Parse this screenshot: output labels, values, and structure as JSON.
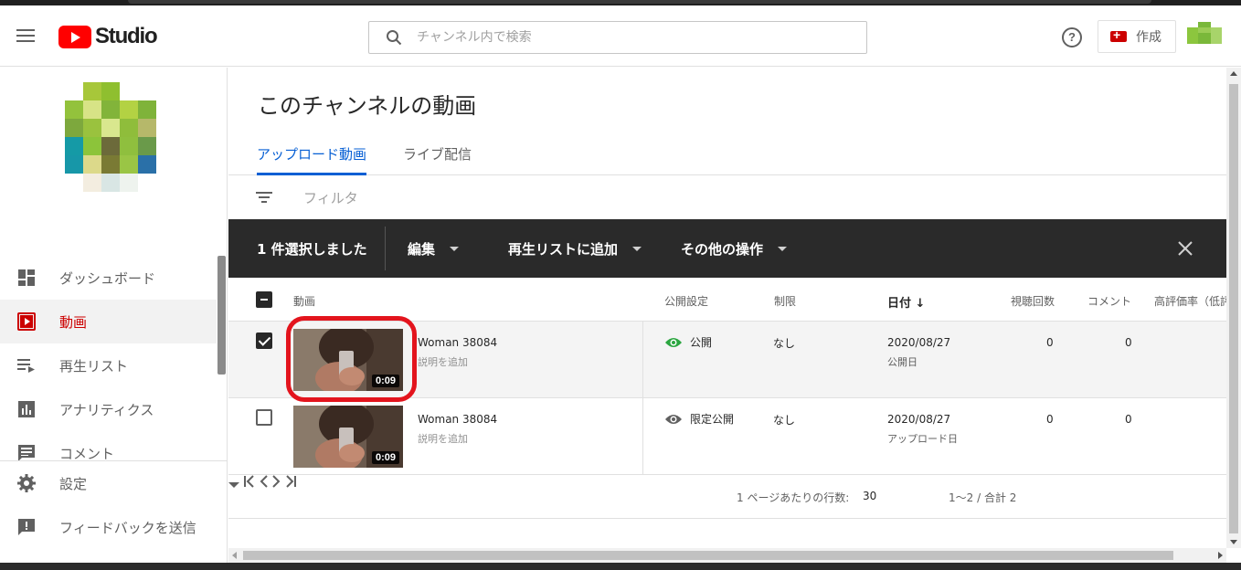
{
  "header": {
    "logo_text": "Studio",
    "search_placeholder": "チャンネル内で検索",
    "help_label": "?",
    "create_label": "作成"
  },
  "sidebar": {
    "items": [
      {
        "label": "ダッシュボード",
        "icon": "dashboard-icon"
      },
      {
        "label": "動画",
        "icon": "video-icon",
        "active": true
      },
      {
        "label": "再生リスト",
        "icon": "playlist-icon"
      },
      {
        "label": "アナリティクス",
        "icon": "analytics-icon"
      },
      {
        "label": "コメント",
        "icon": "comment-icon"
      }
    ],
    "bottom_items": [
      {
        "label": "設定",
        "icon": "gear-icon"
      },
      {
        "label": "フィードバックを送信",
        "icon": "feedback-icon"
      }
    ]
  },
  "main": {
    "title": "このチャンネルの動画",
    "tabs": [
      {
        "label": "アップロード動画",
        "active": true
      },
      {
        "label": "ライブ配信"
      }
    ],
    "filter_label": "フィルタ",
    "bulk": {
      "count_label": "1 件選択しました",
      "edit_label": "編集",
      "add_playlist_label": "再生リストに追加",
      "more_label": "その他の操作"
    },
    "columns": {
      "video": "動画",
      "visibility": "公開設定",
      "restrictions": "制限",
      "date": "日付",
      "views": "視聴回数",
      "comments": "コメント",
      "likes": "高評価率（低評"
    },
    "rows": [
      {
        "title": "Woman 38084",
        "desc": "説明を追加",
        "duration": "0:09",
        "visibility": "公開",
        "restrictions": "なし",
        "date": "2020/08/27",
        "date_sub": "公開日",
        "views": "0",
        "comments": "0",
        "checked": true
      },
      {
        "title": "Woman 38084",
        "desc": "説明を追加",
        "duration": "0:09",
        "visibility": "限定公開",
        "restrictions": "なし",
        "date": "2020/08/27",
        "date_sub": "アップロード日",
        "views": "0",
        "comments": "0",
        "checked": false
      }
    ],
    "pager": {
      "rows_per_page_label": "1 ページあたりの行数:",
      "rows_per_page_value": "30",
      "range_label": "1～2 / 合計 2"
    }
  },
  "colors": {
    "brand_red": "#ff0000",
    "accent_blue": "#065fd4",
    "active_red": "#cc0000",
    "public_green": "#2ba640",
    "highlight_red": "#e3141d"
  }
}
